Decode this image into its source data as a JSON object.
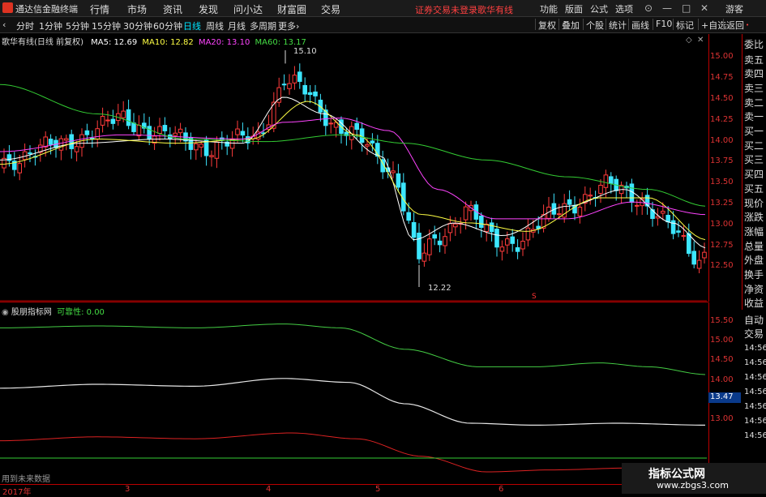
{
  "app": {
    "title": "通达信金融终端",
    "menu": [
      "行情",
      "市场",
      "资讯",
      "发现",
      "问小达",
      "财富圈",
      "交易"
    ],
    "notice": "证券交易未登录",
    "stock_name": "歌华有线",
    "right_menu": [
      "功能",
      "版面",
      "公式",
      "选项"
    ],
    "guest": "游客",
    "window_buttons": [
      "⊙",
      "—",
      "□",
      "✕"
    ]
  },
  "toolbar": {
    "periods": [
      "分时",
      "1分钟",
      "5分钟",
      "15分钟",
      "30分钟",
      "60分钟",
      "日线",
      "周线",
      "月线",
      "多周期",
      "更多›"
    ],
    "active": "日线",
    "right_buttons": [
      "复权",
      "叠加",
      "个股",
      "统计",
      "画线",
      "F10",
      "标记",
      "+自选",
      "返回"
    ]
  },
  "price_panel": {
    "legend_title": "歌华有线(日线 前复权)",
    "ma": [
      {
        "label": "MA5: 12.69",
        "color": "#ffffff"
      },
      {
        "label": "MA10: 12.82",
        "color": "#ffff44"
      },
      {
        "label": "MA20: 13.10",
        "color": "#ff44ff"
      },
      {
        "label": "MA60: 13.17",
        "color": "#44dd44"
      }
    ],
    "high_label": "15.10",
    "low_label": "12.22",
    "marker_s": "S",
    "ticks": [
      "15.00",
      "14.75",
      "14.50",
      "14.25",
      "14.00",
      "13.75",
      "13.50",
      "13.25",
      "13.00",
      "12.75",
      "12.50"
    ]
  },
  "indicator_panel": {
    "title": "股朋指标网",
    "param": "可靠性: 0.00",
    "ticks": [
      "15.50",
      "15.00",
      "14.50",
      "14.00",
      "13.50",
      "13.00"
    ],
    "current": "13.47"
  },
  "sidebar": {
    "items": [
      "委比",
      "卖五",
      "卖四",
      "卖三",
      "卖二",
      "卖一",
      "买一",
      "买二",
      "买三",
      "买四",
      "买五",
      "现价",
      "涨跌",
      "涨幅",
      "总量",
      "外盘",
      "换手",
      "净资",
      "收益"
    ],
    "auto": "自动",
    "trade": "交易",
    "times": [
      "14:56",
      "14:56",
      "14:56",
      "14:56",
      "14:56",
      "14:56",
      "14:56"
    ]
  },
  "bottom": {
    "label": "用到未来数据",
    "dates": [
      "2017年",
      "3",
      "4",
      "5",
      "6"
    ]
  },
  "watermark": {
    "line1": "指标公式网",
    "line2": "www.zbgs3.com"
  }
}
